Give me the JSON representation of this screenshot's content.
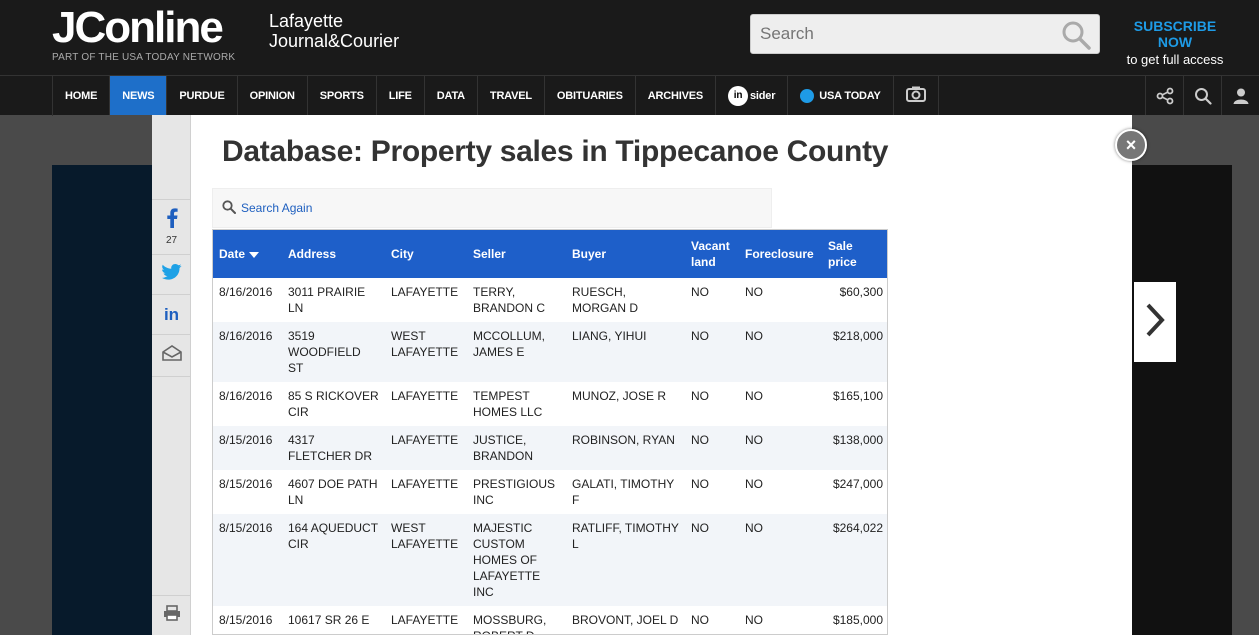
{
  "header": {
    "logo": "JConline",
    "logo_sub_line1": "Lafayette",
    "logo_sub_line2": "Journal&Courier",
    "network": "PART OF THE USA TODAY NETWORK",
    "search_placeholder": "Search",
    "subscribe_line1": "SUBSCRIBE NOW",
    "subscribe_line2": "to get full access"
  },
  "nav": {
    "items": [
      {
        "label": "HOME"
      },
      {
        "label": "NEWS",
        "active": true
      },
      {
        "label": "PURDUE"
      },
      {
        "label": "OPINION"
      },
      {
        "label": "SPORTS"
      },
      {
        "label": "LIFE"
      },
      {
        "label": "DATA"
      },
      {
        "label": "TRAVEL"
      },
      {
        "label": "OBITUARIES"
      },
      {
        "label": "ARCHIVES"
      }
    ],
    "insider_badge": "in",
    "insider_label": "sider",
    "usatoday_label": "USA TODAY"
  },
  "modal": {
    "title": "Database: Property sales in Tippecanoe County",
    "search_again": "Search Again",
    "share_count": "27",
    "close_label": "×"
  },
  "table": {
    "headers": {
      "date": "Date",
      "address": "Address",
      "city": "City",
      "seller": "Seller",
      "buyer": "Buyer",
      "vacant_line1": "Vacant",
      "vacant_line2": "land",
      "foreclosure": "Foreclosure",
      "price_line1": "Sale",
      "price_line2": "price"
    },
    "rows": [
      {
        "date": "8/16/2016",
        "address": "3011 PRAIRIE LN",
        "city": "LAFAYETTE",
        "seller": "TERRY, BRANDON C",
        "buyer": "RUESCH, MORGAN D",
        "vacant": "NO",
        "foreclosure": "NO",
        "price": "$60,300"
      },
      {
        "date": "8/16/2016",
        "address": "3519 WOODFIELD ST",
        "city": "WEST LAFAYETTE",
        "seller": "MCCOLLUM, JAMES E",
        "buyer": "LIANG, YIHUI",
        "vacant": "NO",
        "foreclosure": "NO",
        "price": "$218,000"
      },
      {
        "date": "8/16/2016",
        "address": "85 S RICKOVER CIR",
        "city": "LAFAYETTE",
        "seller": "TEMPEST HOMES LLC",
        "buyer": "MUNOZ, JOSE R",
        "vacant": "NO",
        "foreclosure": "NO",
        "price": "$165,100"
      },
      {
        "date": "8/15/2016",
        "address": "4317 FLETCHER DR",
        "city": "LAFAYETTE",
        "seller": "JUSTICE, BRANDON",
        "buyer": "ROBINSON, RYAN",
        "vacant": "NO",
        "foreclosure": "NO",
        "price": "$138,000"
      },
      {
        "date": "8/15/2016",
        "address": "4607 DOE PATH LN",
        "city": "LAFAYETTE",
        "seller": "PRESTIGIOUS INC",
        "buyer": "GALATI, TIMOTHY F",
        "vacant": "NO",
        "foreclosure": "NO",
        "price": "$247,000"
      },
      {
        "date": "8/15/2016",
        "address": "164 AQUEDUCT CIR",
        "city": "WEST LAFAYETTE",
        "seller": "MAJESTIC CUSTOM HOMES OF LAFAYETTE INC",
        "buyer": "RATLIFF, TIMOTHY L",
        "vacant": "NO",
        "foreclosure": "NO",
        "price": "$264,022"
      },
      {
        "date": "8/15/2016",
        "address": "10617 SR 26 E",
        "city": "LAFAYETTE",
        "seller": "MOSSBURG, ROBERT D",
        "buyer": "BROVONT, JOEL D",
        "vacant": "NO",
        "foreclosure": "NO",
        "price": "$185,000"
      }
    ]
  },
  "colors": {
    "accent": "#1e5fc9",
    "subscribe": "#1e9be6",
    "header_bg": "#1a1a1a"
  }
}
